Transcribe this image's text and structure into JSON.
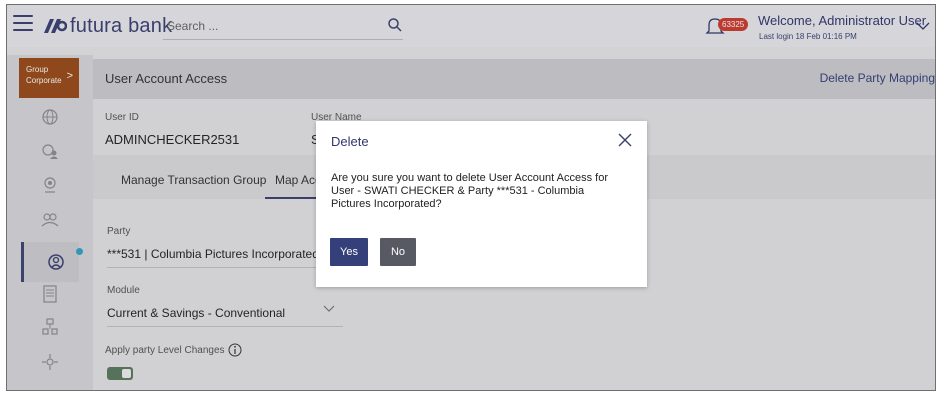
{
  "header": {
    "brand": "futura bank",
    "search_placeholder": "Search ...",
    "notification_count": "63325",
    "welcome": "Welcome, Administrator User",
    "last_login": "Last login 18 Feb 01:16 PM"
  },
  "sidebar": {
    "group_label_line1": "Group",
    "group_label_line2": "Corporate",
    "group_chevron": ">",
    "icons": [
      "globe-icon",
      "users-globe-icon",
      "location-icon",
      "group-icon",
      "user-access-icon",
      "report-icon",
      "settings-tree-icon",
      "workflow-icon"
    ]
  },
  "page": {
    "title": "User Account Access",
    "delete_link": "Delete Party Mapping",
    "user_id_label": "User ID",
    "user_id": "ADMINCHECKER2531",
    "user_name_label": "User Name",
    "user_name_fragment": "S",
    "tabs": [
      "Manage Transaction Group",
      "Map Acc"
    ],
    "party_label": "Party",
    "party_value": "***531 | Columbia Pictures Incorporated ...",
    "module_label": "Module",
    "module_value": "Current & Savings - Conventional",
    "apply_label": "Apply party Level Changes"
  },
  "modal": {
    "title": "Delete",
    "message": "Are you sure you want to delete User Account Access for User - SWATI CHECKER & Party ***531 - Columbia Pictures Incorporated?",
    "yes_label": "Yes",
    "no_label": "No"
  },
  "colors": {
    "brand": "#3a3f73",
    "group_button": "#9a4b17",
    "badge": "#cf3b2f",
    "primary_button": "#35407a",
    "secondary_button": "#575a63",
    "toggle_on": "#5b7a5f"
  }
}
